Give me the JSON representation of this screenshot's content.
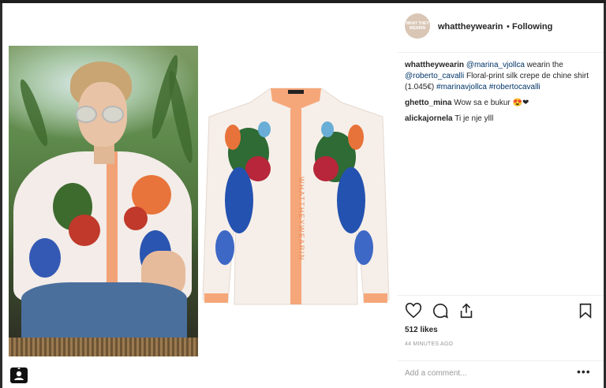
{
  "header": {
    "avatar_text": "WHAT THEY WEARIN",
    "username": "whattheywearin",
    "separator": "•",
    "follow_status": "Following"
  },
  "caption": {
    "username": "whattheywearin",
    "mention1": "@marina_vjollca",
    "text1": " wearin the",
    "mention2": "@roberto_cavalli",
    "text2": " Floral-print silk crepe de chine shirt (1.045€)",
    "tag1": "#marinavjollca",
    "tag2": "#robertocavalli"
  },
  "comments": [
    {
      "user": "ghetto_mina",
      "text": "Wow sa e bukur 😍❤"
    },
    {
      "user": "alickajornela",
      "text": "Ti je nje ylll"
    }
  ],
  "product": {
    "watermark": "WHATTHEYWEARIN"
  },
  "stats": {
    "likes": "512 likes",
    "time": "44 MINUTES AGO"
  },
  "comment_box": {
    "placeholder": "Add a comment...",
    "more": "•••"
  },
  "icons": [
    "heart-icon",
    "comment-icon",
    "share-icon",
    "bookmark-icon",
    "tagged-user-icon"
  ]
}
